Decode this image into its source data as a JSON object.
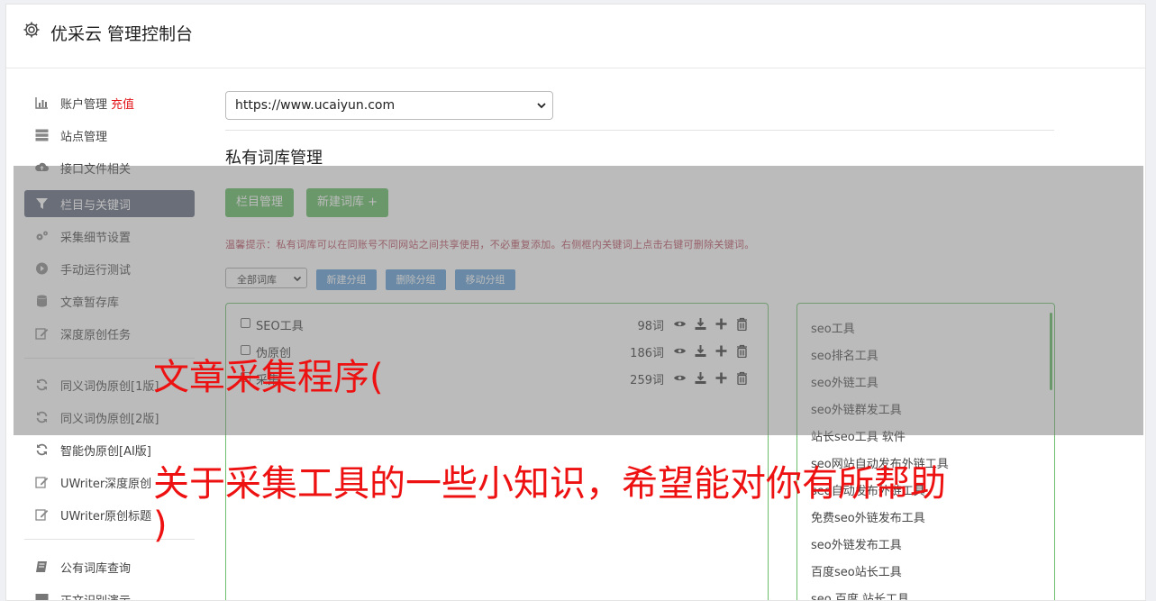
{
  "header": {
    "title": "优采云 管理控制台"
  },
  "sidebar": {
    "items": [
      {
        "label": "账户管理",
        "badge": "充值",
        "icon": "bar-chart-icon"
      },
      {
        "label": "站点管理",
        "icon": "server-icon"
      },
      {
        "label": "接口文件相关",
        "icon": "cloud-upload-icon"
      },
      {
        "label": "栏目与关键词",
        "icon": "filter-icon",
        "active": true
      },
      {
        "label": "采集细节设置",
        "icon": "cogs-icon"
      },
      {
        "label": "手动运行测试",
        "icon": "play-circle-icon"
      },
      {
        "label": "文章暂存库",
        "icon": "database-icon"
      },
      {
        "label": "深度原创任务",
        "icon": "edit-icon"
      },
      {
        "label": "同义词伪原创[1版]",
        "icon": "refresh-icon"
      },
      {
        "label": "同义词伪原创[2版]",
        "icon": "refresh-icon"
      },
      {
        "label": "智能伪原创[AI版]",
        "icon": "refresh-icon"
      },
      {
        "label": "UWriter深度原创",
        "icon": "edit-icon"
      },
      {
        "label": "UWriter原创标题",
        "icon": "edit-icon"
      },
      {
        "label": "公有词库查询",
        "icon": "book-icon"
      },
      {
        "label": "正文识别演示",
        "icon": "monitor-icon"
      }
    ]
  },
  "main": {
    "site_select": "https://www.ucaiyun.com",
    "heading": "私有词库管理",
    "btn_columns": "栏目管理",
    "btn_new_lib": "新建词库 +",
    "tip": "温馨提示：私有词库可以在同账号不同网站之间共享使用，不必重复添加。右侧框内关键词上点击右键可删除关键词。",
    "group_select": "全部词库",
    "btn_new_group": "新建分组",
    "btn_del_group": "删除分组",
    "btn_move_group": "移动分组",
    "libraries": [
      {
        "name": "SEO工具",
        "count": "98词"
      },
      {
        "name": "伪原创",
        "count": "186词"
      },
      {
        "name": "采集",
        "count": "259词"
      }
    ],
    "keywords": [
      "seo工具",
      "seo排名工具",
      "seo外链工具",
      "seo外链群发工具",
      "站长seo工具 软件",
      "seo网站自动发布外链工具",
      "seo自动发布外链工具",
      "免费seo外链发布工具",
      "seo外链发布工具",
      "百度seo站长工具",
      "seo 百度 站长工具"
    ]
  },
  "overlay": {
    "line1": "文章采集程序(",
    "line2": "关于采集工具的一些小知识，希望能对你有所帮助",
    "line3": ")"
  },
  "colors": {
    "overlay_text": "#ee1111",
    "active_sidebar": "#5b6478",
    "green_button": "#5cb85c",
    "blue_button": "#5b9bd5"
  }
}
